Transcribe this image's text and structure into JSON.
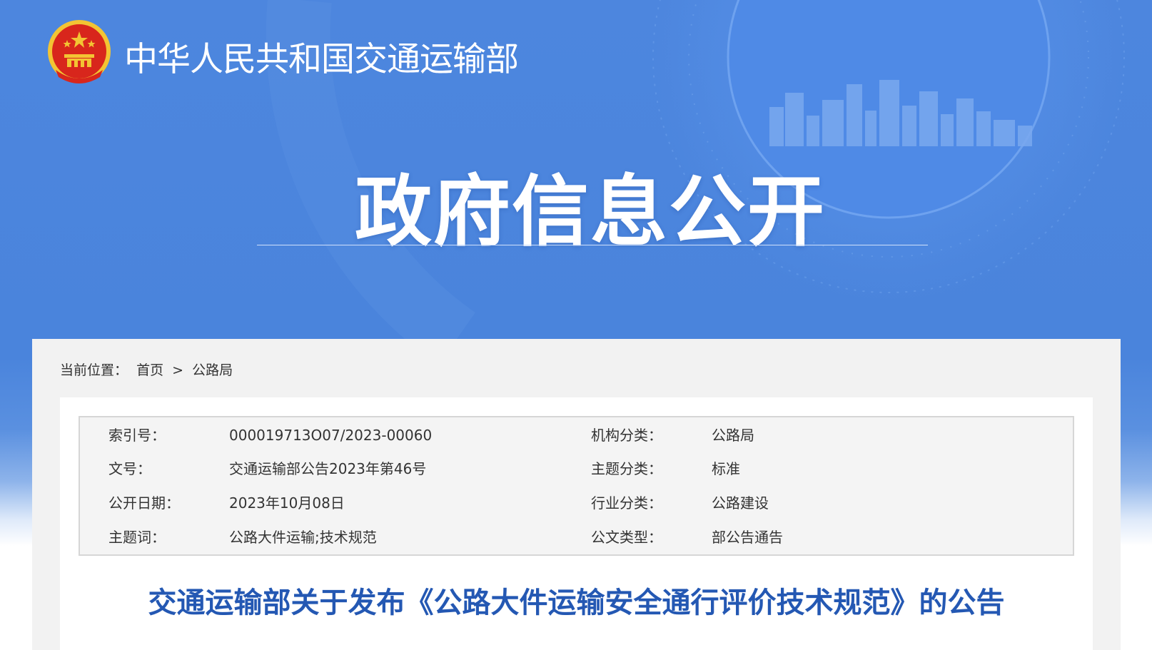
{
  "header": {
    "ministry_name": "中华人民共和国交通运输部",
    "banner_title": "政府信息公开"
  },
  "breadcrumb": {
    "prefix": "当前位置：",
    "home": "首页",
    "separator": ">",
    "current": "公路局"
  },
  "info": {
    "rows": [
      {
        "label1": "索引号：",
        "value1": "000019713O07/2023-00060",
        "label2": "机构分类：",
        "value2": "公路局"
      },
      {
        "label1": "文号：",
        "value1": "交通运输部公告2023年第46号",
        "label2": "主题分类：",
        "value2": "标准"
      },
      {
        "label1": "公开日期：",
        "value1": "2023年10月08日",
        "label2": "行业分类：",
        "value2": "公路建设"
      },
      {
        "label1": "主题词：",
        "value1": "公路大件运输;技术规范",
        "label2": "公文类型：",
        "value2": "部公告通告"
      }
    ]
  },
  "document": {
    "title": "交通运输部关于发布《公路大件运输安全通行评价技术规范》的公告"
  },
  "colors": {
    "banner_blue": "#4a84dc",
    "title_blue": "#2458b3",
    "emblem_red": "#d8261c",
    "emblem_gold": "#f3c433"
  },
  "icons": {
    "emblem": "national-emblem-icon"
  }
}
